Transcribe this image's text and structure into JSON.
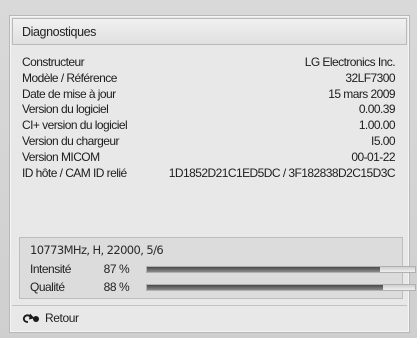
{
  "dialog": {
    "title": "Diagnostiques"
  },
  "info": [
    {
      "label": "Constructeur",
      "value": "LG Electronics Inc."
    },
    {
      "label": "Modèle / Référence",
      "value": "32LF7300"
    },
    {
      "label": "Date de mise à jour",
      "value": "15 mars 2009"
    },
    {
      "label": "Version du logiciel",
      "value": "0.00.39"
    },
    {
      "label": "CI+ version du logiciel",
      "value": "1.00.00"
    },
    {
      "label": "Version du chargeur",
      "value": "I5.00"
    },
    {
      "label": "Version MICOM",
      "value": "00-01-22"
    },
    {
      "label": "ID hôte / CAM ID relié",
      "value": "1D1852D21C1ED5DC / 3F182838D2C15D3C"
    }
  ],
  "signal": {
    "frequency": "10773MHz, H, 22000, 5/6",
    "intensity": {
      "label": "Intensité",
      "value": "87",
      "unit": "%",
      "level": 0.87
    },
    "quality": {
      "label": "Qualité",
      "value": "88",
      "unit": "%",
      "level": 0.88
    }
  },
  "footer": {
    "back_label": "Retour",
    "back_icon": "return-arrow-icon"
  }
}
